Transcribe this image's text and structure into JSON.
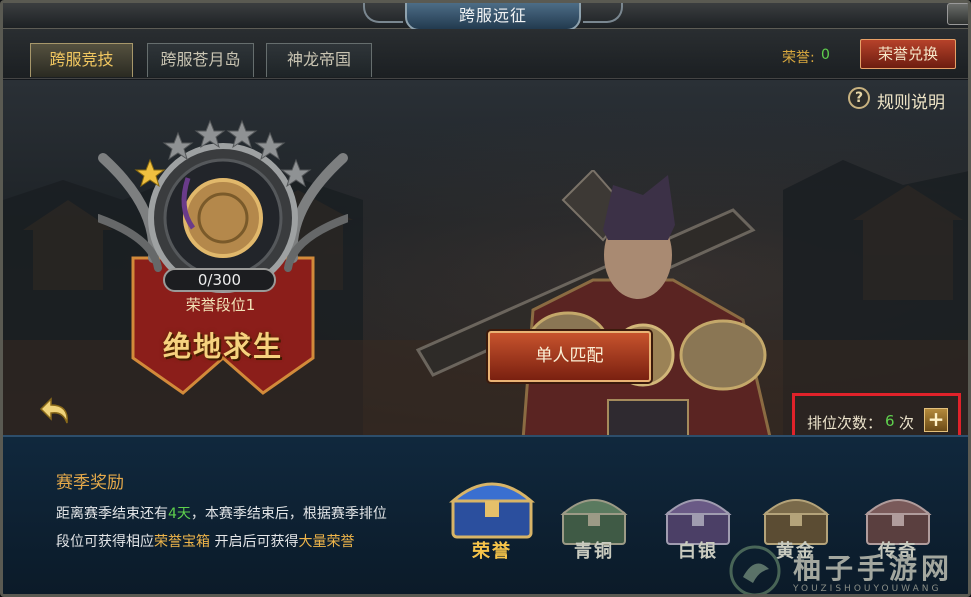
{
  "window": {
    "title": "跨服远征"
  },
  "tabs": [
    {
      "label": "跨服竞技",
      "active": true
    },
    {
      "label": "跨服苍月岛",
      "active": false
    },
    {
      "label": "神龙帝国",
      "active": false
    }
  ],
  "honor": {
    "label": "荣誉:",
    "value": "0",
    "exchange_button": "荣誉兑换"
  },
  "rules": {
    "label": "规则说明"
  },
  "rank": {
    "progress": "0/300",
    "progress_current": 0,
    "progress_max": 300,
    "tier_label": "荣誉段位1",
    "name": "绝地求生",
    "stars_filled": 1,
    "stars_total": 6
  },
  "match_button": "单人匹配",
  "ranking_count": {
    "label": "排位次数：",
    "value": "6",
    "unit": "次",
    "add_symbol": "+"
  },
  "season_reward": {
    "title": "赛季奖励",
    "line1_a": "距离赛季结束还有",
    "line1_days": "4天",
    "line1_b": "，本赛季结束后，根据赛季排位",
    "line2_a": "段位可获得相应",
    "line2_box": "荣誉宝箱",
    "line2_b": " 开启后可获得",
    "line2_honor": "大量荣誉"
  },
  "chests": [
    {
      "label": "荣誉",
      "color": "#3a6fd0",
      "label_color": "#f6c44a"
    },
    {
      "label": "青铜",
      "color": "#5a7a5f",
      "label_color": "#c9cbbf"
    },
    {
      "label": "白银",
      "color": "#6a5a86",
      "label_color": "#c9cbbf"
    },
    {
      "label": "黄金",
      "color": "#7a6a4a",
      "label_color": "#c9cbbf"
    },
    {
      "label": "传奇",
      "color": "#7a5a5a",
      "label_color": "#c9cbbf"
    }
  ],
  "watermark": {
    "text": "柚子手游网",
    "sub": "YOUZISHOUYOUWANG"
  },
  "colors": {
    "accent_gold": "#efb54a",
    "highlight_green": "#5fd04d",
    "alert_red": "#e0222a"
  }
}
